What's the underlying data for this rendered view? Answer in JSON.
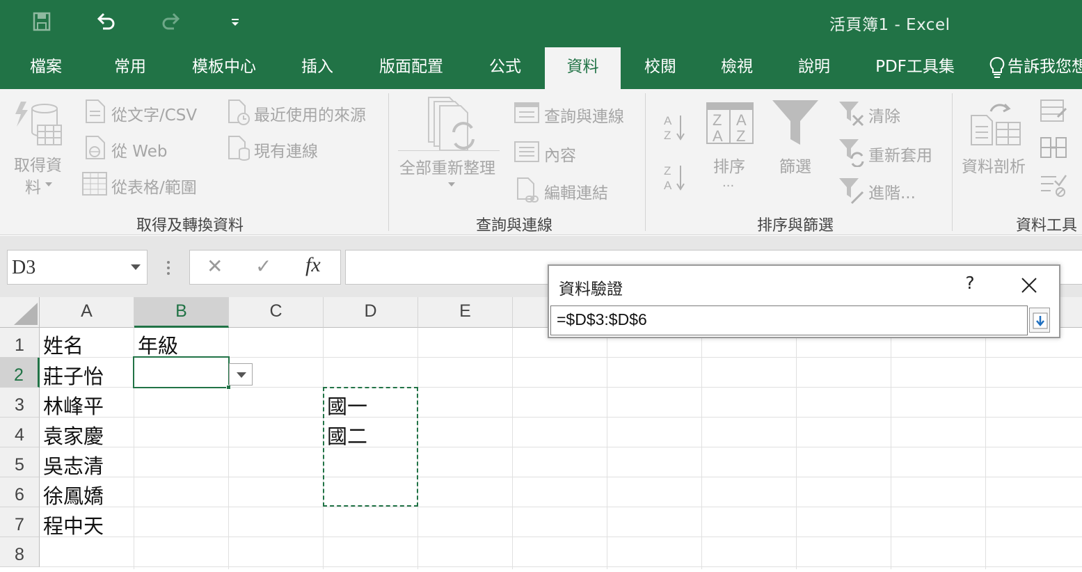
{
  "title_bar": {
    "window_title": "活頁簿1  -  Excel",
    "qat_icons": [
      "save-icon",
      "undo-icon",
      "redo-icon",
      "customize-qat-icon"
    ]
  },
  "tabs": [
    {
      "label": "檔案"
    },
    {
      "label": "常用"
    },
    {
      "label": "模板中心"
    },
    {
      "label": "插入"
    },
    {
      "label": "版面配置"
    },
    {
      "label": "公式"
    },
    {
      "label": "資料",
      "active": true
    },
    {
      "label": "校閱"
    },
    {
      "label": "檢視"
    },
    {
      "label": "說明"
    },
    {
      "label": "PDF工具集"
    },
    {
      "label": "告訴我您想"
    }
  ],
  "ribbon": {
    "get_transform": {
      "group_label": "取得及轉換資料",
      "get_data_line1": "取得資",
      "get_data_line2": "料",
      "from_text_csv": "從文字/CSV",
      "from_web": "從 Web",
      "from_table_range": "從表格/範圍",
      "recent_sources": "最近使用的來源",
      "existing_connections": "現有連線"
    },
    "queries_connections": {
      "group_label": "查詢與連線",
      "refresh_all": "全部重新整理",
      "queries_and_connections": "查詢與連線",
      "properties": "內容",
      "edit_links": "編輯連結"
    },
    "sort_filter": {
      "group_label": "排序與篩選",
      "sort_line1": "排序",
      "sort_line2": "...",
      "filter": "篩選",
      "clear": "清除",
      "reapply": "重新套用",
      "advanced": "進階..."
    },
    "data_tools": {
      "group_label": "資料工具",
      "text_to_columns": "資料剖析"
    }
  },
  "formula_bar": {
    "name_box": "D3",
    "cancel_symbol": "✕",
    "enter_symbol": "✓",
    "fx_symbol": "fx",
    "formula": ""
  },
  "sheet": {
    "columns": [
      "A",
      "B",
      "C",
      "D",
      "E"
    ],
    "selected_column": "B",
    "rows": [
      "1",
      "2",
      "3",
      "4",
      "5",
      "6",
      "7",
      "8"
    ],
    "selected_row": "2",
    "cells": {
      "A1": "姓名",
      "B1": "年級",
      "A2": "莊子怡",
      "A3": "林峰平",
      "D3": "國一",
      "A4": "袁家慶",
      "D4": "國二",
      "A5": "吳志清",
      "A6": "徐鳳嬌",
      "A7": "程中天"
    }
  },
  "dialog": {
    "title": "資料驗證",
    "help": "?",
    "input_value": "=$D$3:$D$6"
  },
  "colors": {
    "accent": "#217346",
    "ribbon_bg": "#f3f3f3"
  }
}
